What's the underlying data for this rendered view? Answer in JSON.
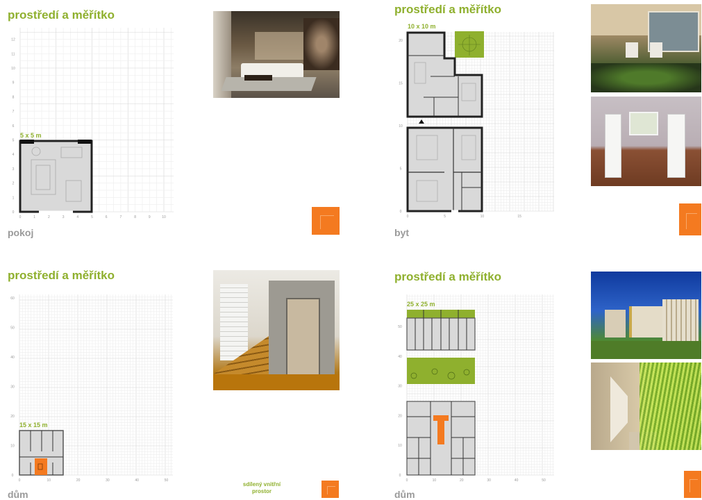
{
  "panels": {
    "pokoj": {
      "title": "prostředí a měřítko",
      "dimension": "5 x 5 m",
      "caption": "pokoj",
      "x_ticks": [
        "0",
        "1",
        "2",
        "3",
        "4",
        "5",
        "6",
        "7",
        "8",
        "9",
        "10"
      ],
      "y_ticks": [
        "0",
        "1",
        "2",
        "3",
        "4",
        "5",
        "6",
        "7",
        "8",
        "9",
        "10",
        "11",
        "12"
      ]
    },
    "byt": {
      "title": "prostředí a měřítko",
      "dimension": "10 x 10 m",
      "caption": "byt",
      "x_ticks": [
        "0",
        "5",
        "10",
        "15"
      ],
      "y_ticks": [
        "0",
        "5",
        "10",
        "15",
        "20"
      ]
    },
    "dum1": {
      "title": "prostředí a měřítko",
      "dimension": "15 x 15 m",
      "caption": "dům",
      "note_line1": "sdílený vnitřní",
      "note_line2": "prostor",
      "x_ticks": [
        "0",
        "10",
        "20",
        "30",
        "40",
        "50"
      ],
      "y_ticks": [
        "0",
        "10",
        "20",
        "30",
        "40",
        "50",
        "60"
      ]
    },
    "dum2": {
      "title": "prostředí a měřítko",
      "dimension": "25 x 25 m",
      "caption": "dům",
      "x_ticks": [
        "0",
        "10",
        "20",
        "30",
        "40",
        "50"
      ],
      "y_ticks": [
        "0",
        "10",
        "20",
        "30",
        "40",
        "50"
      ]
    }
  },
  "colors": {
    "accent_green": "#8fb02e",
    "accent_orange": "#f47a20",
    "caption_gray": "#9a9a9a",
    "plan_fill": "#d9d9d9"
  },
  "icons": [
    "orange-scale-swatch"
  ]
}
